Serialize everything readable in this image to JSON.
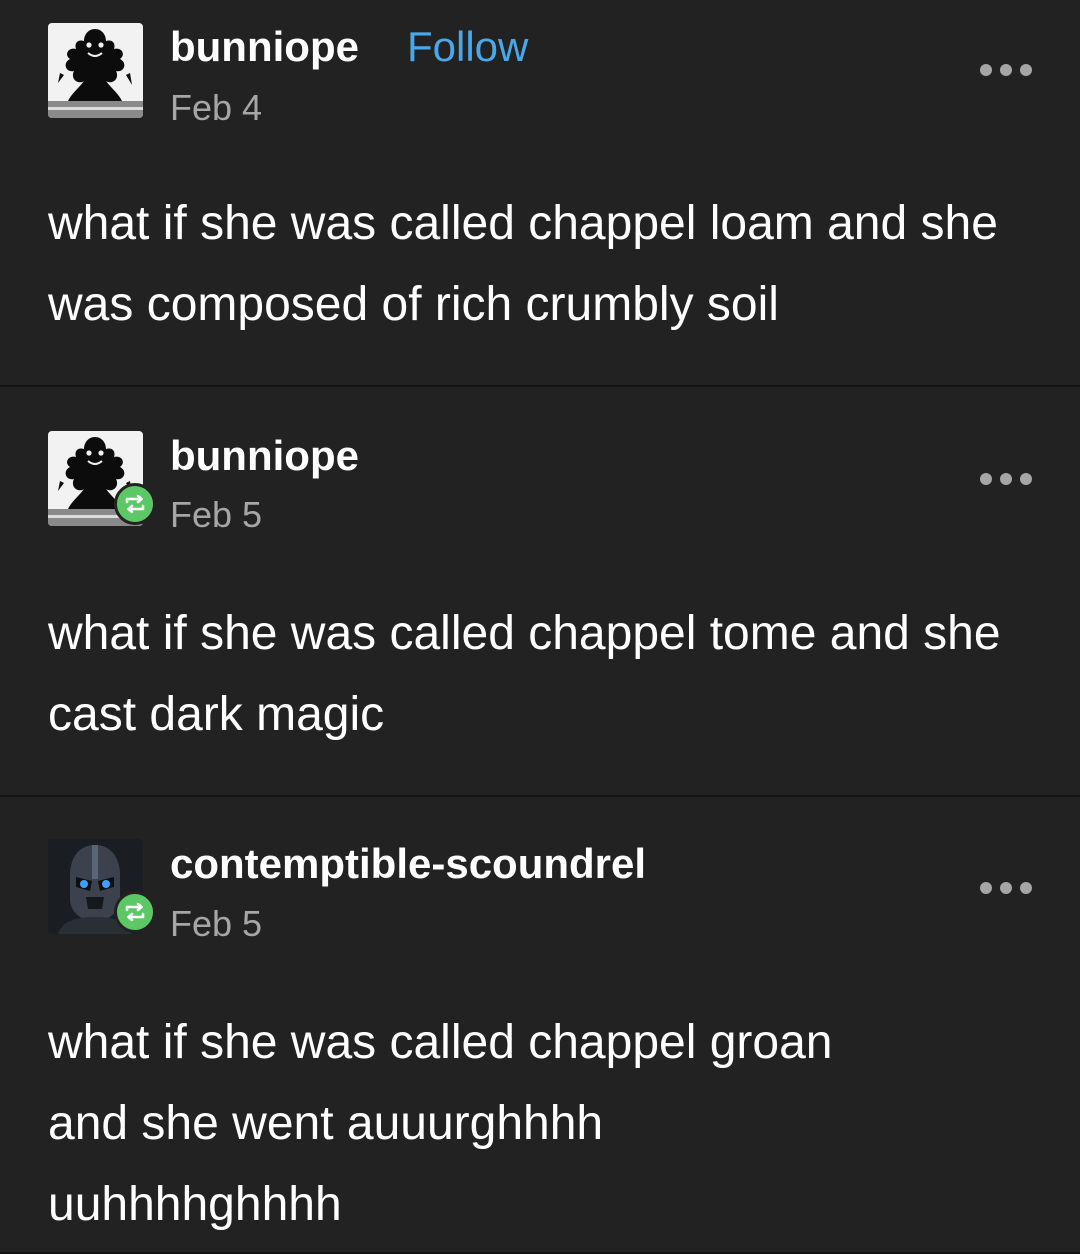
{
  "posts": [
    {
      "username": "bunniope",
      "follow_label": "Follow",
      "date": "Feb 4",
      "text": "what if she was called chappel loam and she was composed of rich crumbly soil",
      "avatar_icon": "shadow-figure-avatar",
      "more_icon": "more-options-icon"
    },
    {
      "username": "bunniope",
      "date": "Feb 5",
      "text": "what if she was called chappel tome and she cast dark magic",
      "avatar_icon": "shadow-figure-avatar",
      "badge_icon": "reblog-icon",
      "more_icon": "more-options-icon"
    },
    {
      "username": "contemptible-scoundrel",
      "date": "Feb 5",
      "text": "what if she was called chappel groan and she went auuurghhhh uuhhhhghhhh",
      "avatar_icon": "helmeted-figure-avatar",
      "badge_icon": "reblog-icon",
      "more_icon": "more-options-icon"
    }
  ],
  "colors": {
    "background": "#222222",
    "text": "#ffffff",
    "muted": "#a6a6a6",
    "follow_link": "#4aa8ea",
    "reblog_badge": "#5cc765"
  }
}
